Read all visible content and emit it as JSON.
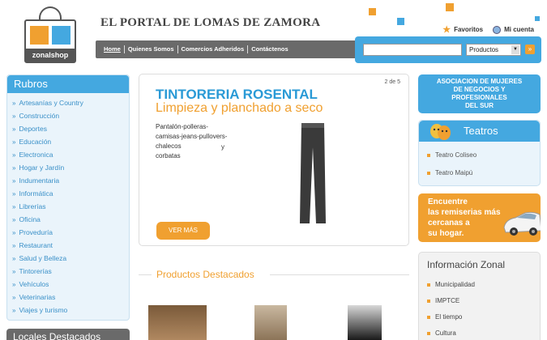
{
  "header": {
    "logo_text": "zonalshop",
    "site_title": "EL PORTAL DE LOMAS DE ZAMORA",
    "favoritos": "Favoritos",
    "mi_cuenta": "Mi cuenta"
  },
  "nav": [
    "Home",
    "Quienes Somos",
    "Comercios Adheridos",
    "Contáctenos"
  ],
  "search": {
    "query": "",
    "category": "Productos",
    "go": "»"
  },
  "sidebar": {
    "title": "Rubros",
    "items": [
      "Artesanías y Country",
      "Construcción",
      "Deportes",
      "Educación",
      "Electronica",
      "Hogar y Jardín",
      "Indumentaria",
      "Informática",
      "Librerías",
      "Oficina",
      "Proveduría",
      "Restaurant",
      "Salud y Belleza",
      "Tintorerías",
      "Vehículos",
      "Veterinarias",
      "Viajes y turismo"
    ],
    "locales_title": "Locales Destacados"
  },
  "feature": {
    "pager": "2 de 5",
    "title": "TINTORERIA ROSENTAL",
    "subtitle": "Limpieza y planchado a seco",
    "desc": "Pantalón-polleras-camisas-jeans-pullovers-chalecos",
    "desc_y": "y",
    "desc_end": "corbatas",
    "button": "VER MÁS"
  },
  "destacados": {
    "title": "Productos Destacados"
  },
  "right": {
    "asociacion": [
      "ASOCIACION DE MUJERES",
      "DE NEGOCIOS Y",
      "PROFESIONALES",
      "DEL SUR"
    ],
    "teatros": {
      "title": "Teatros",
      "items": [
        "Teatro Coliseo",
        "Teatro Maipú"
      ]
    },
    "remis": [
      "Encuentre",
      "las remiserias más",
      "cercanas a",
      "su hogar."
    ],
    "info": {
      "title": "Información Zonal",
      "items": [
        "Municipalidad",
        "IMPTCE",
        "El tiempo",
        "Cultura"
      ]
    }
  },
  "colors": {
    "accent_blue": "#44a8e0",
    "accent_orange": "#f0a030",
    "nav_gray": "#6a6a6a"
  }
}
